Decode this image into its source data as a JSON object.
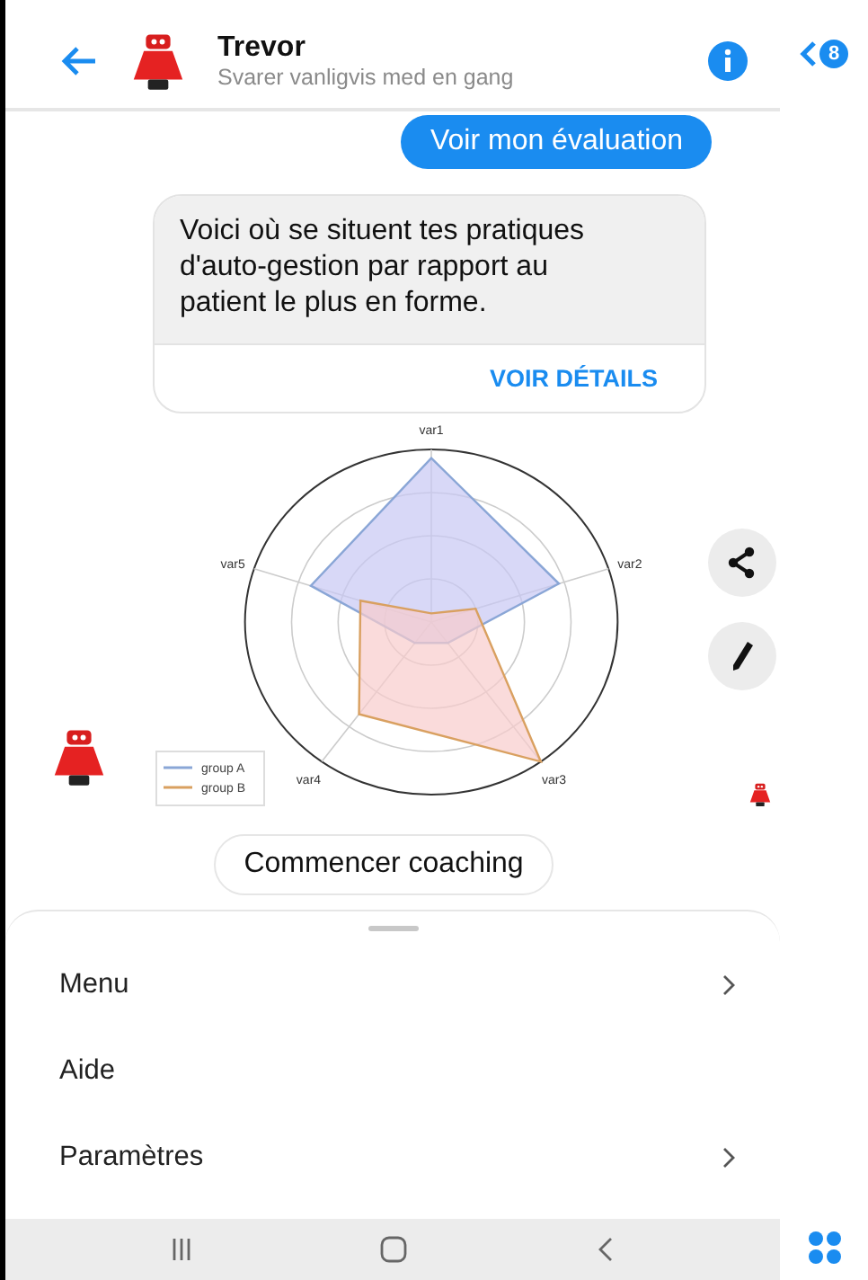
{
  "header": {
    "name": "Trevor",
    "status": "Svarer vanligvis med en gang"
  },
  "side_badge": {
    "count": "8"
  },
  "user_message": "Voir mon évaluation",
  "bot_card": {
    "text": "Voici où se situent tes pratiques d'auto-gestion par rapport au patient le plus en forme.",
    "action": "VOIR DÉTAILS"
  },
  "radar": {
    "axes": [
      "var1",
      "var2",
      "var3",
      "var4",
      "var5"
    ],
    "legend": [
      {
        "name": "group A",
        "color": "#8aa6d6"
      },
      {
        "name": "group B",
        "color": "#d9a060"
      }
    ]
  },
  "quick_reply": "Commencer coaching",
  "menu": [
    {
      "label": "Menu",
      "has_submenu": true
    },
    {
      "label": "Aide",
      "has_submenu": false
    },
    {
      "label": "Paramètres",
      "has_submenu": true
    }
  ]
}
